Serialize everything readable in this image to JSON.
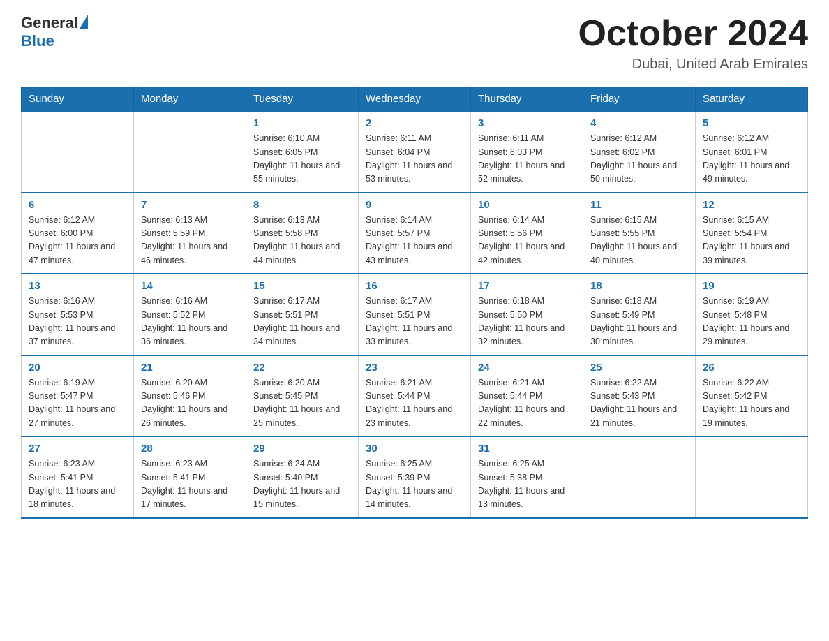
{
  "header": {
    "logo_general": "General",
    "logo_blue": "Blue",
    "month_title": "October 2024",
    "location": "Dubai, United Arab Emirates"
  },
  "weekdays": [
    "Sunday",
    "Monday",
    "Tuesday",
    "Wednesday",
    "Thursday",
    "Friday",
    "Saturday"
  ],
  "weeks": [
    [
      {
        "day": "",
        "sunrise": "",
        "sunset": "",
        "daylight": ""
      },
      {
        "day": "",
        "sunrise": "",
        "sunset": "",
        "daylight": ""
      },
      {
        "day": "1",
        "sunrise": "Sunrise: 6:10 AM",
        "sunset": "Sunset: 6:05 PM",
        "daylight": "Daylight: 11 hours and 55 minutes."
      },
      {
        "day": "2",
        "sunrise": "Sunrise: 6:11 AM",
        "sunset": "Sunset: 6:04 PM",
        "daylight": "Daylight: 11 hours and 53 minutes."
      },
      {
        "day": "3",
        "sunrise": "Sunrise: 6:11 AM",
        "sunset": "Sunset: 6:03 PM",
        "daylight": "Daylight: 11 hours and 52 minutes."
      },
      {
        "day": "4",
        "sunrise": "Sunrise: 6:12 AM",
        "sunset": "Sunset: 6:02 PM",
        "daylight": "Daylight: 11 hours and 50 minutes."
      },
      {
        "day": "5",
        "sunrise": "Sunrise: 6:12 AM",
        "sunset": "Sunset: 6:01 PM",
        "daylight": "Daylight: 11 hours and 49 minutes."
      }
    ],
    [
      {
        "day": "6",
        "sunrise": "Sunrise: 6:12 AM",
        "sunset": "Sunset: 6:00 PM",
        "daylight": "Daylight: 11 hours and 47 minutes."
      },
      {
        "day": "7",
        "sunrise": "Sunrise: 6:13 AM",
        "sunset": "Sunset: 5:59 PM",
        "daylight": "Daylight: 11 hours and 46 minutes."
      },
      {
        "day": "8",
        "sunrise": "Sunrise: 6:13 AM",
        "sunset": "Sunset: 5:58 PM",
        "daylight": "Daylight: 11 hours and 44 minutes."
      },
      {
        "day": "9",
        "sunrise": "Sunrise: 6:14 AM",
        "sunset": "Sunset: 5:57 PM",
        "daylight": "Daylight: 11 hours and 43 minutes."
      },
      {
        "day": "10",
        "sunrise": "Sunrise: 6:14 AM",
        "sunset": "Sunset: 5:56 PM",
        "daylight": "Daylight: 11 hours and 42 minutes."
      },
      {
        "day": "11",
        "sunrise": "Sunrise: 6:15 AM",
        "sunset": "Sunset: 5:55 PM",
        "daylight": "Daylight: 11 hours and 40 minutes."
      },
      {
        "day": "12",
        "sunrise": "Sunrise: 6:15 AM",
        "sunset": "Sunset: 5:54 PM",
        "daylight": "Daylight: 11 hours and 39 minutes."
      }
    ],
    [
      {
        "day": "13",
        "sunrise": "Sunrise: 6:16 AM",
        "sunset": "Sunset: 5:53 PM",
        "daylight": "Daylight: 11 hours and 37 minutes."
      },
      {
        "day": "14",
        "sunrise": "Sunrise: 6:16 AM",
        "sunset": "Sunset: 5:52 PM",
        "daylight": "Daylight: 11 hours and 36 minutes."
      },
      {
        "day": "15",
        "sunrise": "Sunrise: 6:17 AM",
        "sunset": "Sunset: 5:51 PM",
        "daylight": "Daylight: 11 hours and 34 minutes."
      },
      {
        "day": "16",
        "sunrise": "Sunrise: 6:17 AM",
        "sunset": "Sunset: 5:51 PM",
        "daylight": "Daylight: 11 hours and 33 minutes."
      },
      {
        "day": "17",
        "sunrise": "Sunrise: 6:18 AM",
        "sunset": "Sunset: 5:50 PM",
        "daylight": "Daylight: 11 hours and 32 minutes."
      },
      {
        "day": "18",
        "sunrise": "Sunrise: 6:18 AM",
        "sunset": "Sunset: 5:49 PM",
        "daylight": "Daylight: 11 hours and 30 minutes."
      },
      {
        "day": "19",
        "sunrise": "Sunrise: 6:19 AM",
        "sunset": "Sunset: 5:48 PM",
        "daylight": "Daylight: 11 hours and 29 minutes."
      }
    ],
    [
      {
        "day": "20",
        "sunrise": "Sunrise: 6:19 AM",
        "sunset": "Sunset: 5:47 PM",
        "daylight": "Daylight: 11 hours and 27 minutes."
      },
      {
        "day": "21",
        "sunrise": "Sunrise: 6:20 AM",
        "sunset": "Sunset: 5:46 PM",
        "daylight": "Daylight: 11 hours and 26 minutes."
      },
      {
        "day": "22",
        "sunrise": "Sunrise: 6:20 AM",
        "sunset": "Sunset: 5:45 PM",
        "daylight": "Daylight: 11 hours and 25 minutes."
      },
      {
        "day": "23",
        "sunrise": "Sunrise: 6:21 AM",
        "sunset": "Sunset: 5:44 PM",
        "daylight": "Daylight: 11 hours and 23 minutes."
      },
      {
        "day": "24",
        "sunrise": "Sunrise: 6:21 AM",
        "sunset": "Sunset: 5:44 PM",
        "daylight": "Daylight: 11 hours and 22 minutes."
      },
      {
        "day": "25",
        "sunrise": "Sunrise: 6:22 AM",
        "sunset": "Sunset: 5:43 PM",
        "daylight": "Daylight: 11 hours and 21 minutes."
      },
      {
        "day": "26",
        "sunrise": "Sunrise: 6:22 AM",
        "sunset": "Sunset: 5:42 PM",
        "daylight": "Daylight: 11 hours and 19 minutes."
      }
    ],
    [
      {
        "day": "27",
        "sunrise": "Sunrise: 6:23 AM",
        "sunset": "Sunset: 5:41 PM",
        "daylight": "Daylight: 11 hours and 18 minutes."
      },
      {
        "day": "28",
        "sunrise": "Sunrise: 6:23 AM",
        "sunset": "Sunset: 5:41 PM",
        "daylight": "Daylight: 11 hours and 17 minutes."
      },
      {
        "day": "29",
        "sunrise": "Sunrise: 6:24 AM",
        "sunset": "Sunset: 5:40 PM",
        "daylight": "Daylight: 11 hours and 15 minutes."
      },
      {
        "day": "30",
        "sunrise": "Sunrise: 6:25 AM",
        "sunset": "Sunset: 5:39 PM",
        "daylight": "Daylight: 11 hours and 14 minutes."
      },
      {
        "day": "31",
        "sunrise": "Sunrise: 6:25 AM",
        "sunset": "Sunset: 5:38 PM",
        "daylight": "Daylight: 11 hours and 13 minutes."
      },
      {
        "day": "",
        "sunrise": "",
        "sunset": "",
        "daylight": ""
      },
      {
        "day": "",
        "sunrise": "",
        "sunset": "",
        "daylight": ""
      }
    ]
  ]
}
